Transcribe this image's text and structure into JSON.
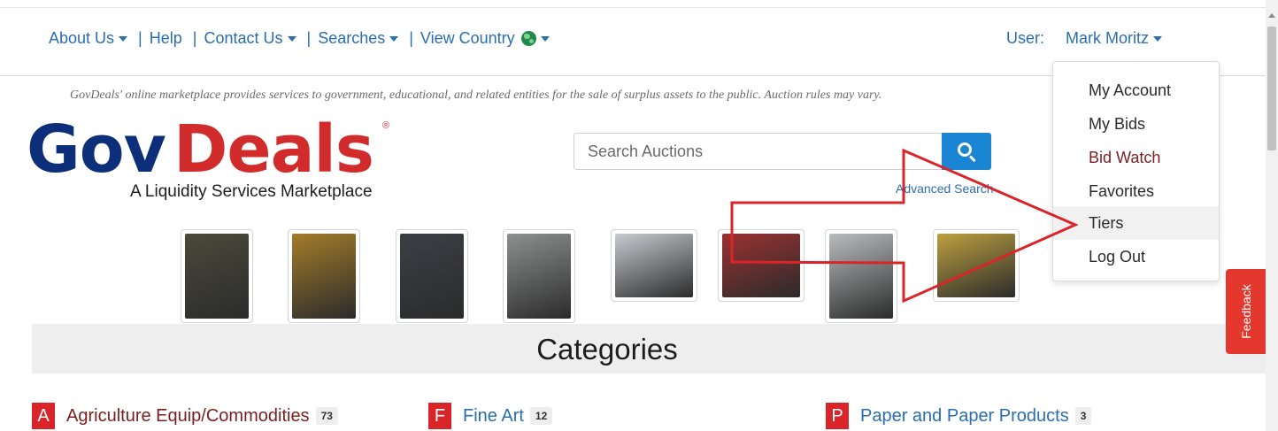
{
  "nav": {
    "about": "About Us",
    "help": "Help",
    "contact": "Contact Us",
    "searches": "Searches",
    "view_country": "View Country",
    "separator": "|",
    "user_label": "User:",
    "user_name": "Mark Moritz"
  },
  "tagline": "GovDeals' online marketplace provides services to government, educational, and related entities for the sale of surplus assets to the public. Auction rules may vary.",
  "logo": {
    "gov": "Gov",
    "deals": "Deals",
    "reg": "®",
    "subtitle": "A Liquidity Services Marketplace"
  },
  "search": {
    "placeholder": "Search Auctions",
    "advanced": "Advanced Search"
  },
  "thumbnails": [
    {
      "icon": "skid-steer-photo",
      "color": "#4a4a3a"
    },
    {
      "icon": "school-bus-photo",
      "color": "#a37c2a"
    },
    {
      "icon": "suv-photo",
      "color": "#3b3f45"
    },
    {
      "icon": "bus-photo",
      "color": "#8e8f8f"
    },
    {
      "icon": "utility-truck-photo",
      "color": "#c7cbd0"
    },
    {
      "icon": "fire-truck-photo",
      "color": "#9b3131"
    },
    {
      "icon": "cabinet-photo",
      "color": "#b9bcbd"
    },
    {
      "icon": "yellow-equipment-photo",
      "color": "#bda040"
    }
  ],
  "categories_title": "Categories",
  "categories": [
    {
      "letter": "A",
      "name": "Agriculture Equip/Commodities",
      "count": "73"
    },
    {
      "letter": "F",
      "name": "Fine Art",
      "count": "12"
    },
    {
      "letter": "P",
      "name": "Paper and Paper Products",
      "count": "3"
    }
  ],
  "user_menu": {
    "items": [
      "My Account",
      "My Bids",
      "Bid Watch",
      "Favorites",
      "Tiers",
      "Log Out"
    ],
    "active": "Tiers"
  },
  "feedback": "Feedback",
  "colors": {
    "link_blue": "#2a6db0",
    "brand_red": "#d22b2b",
    "brand_navy": "#0d2f7a",
    "annotation_red": "#d9252a"
  }
}
